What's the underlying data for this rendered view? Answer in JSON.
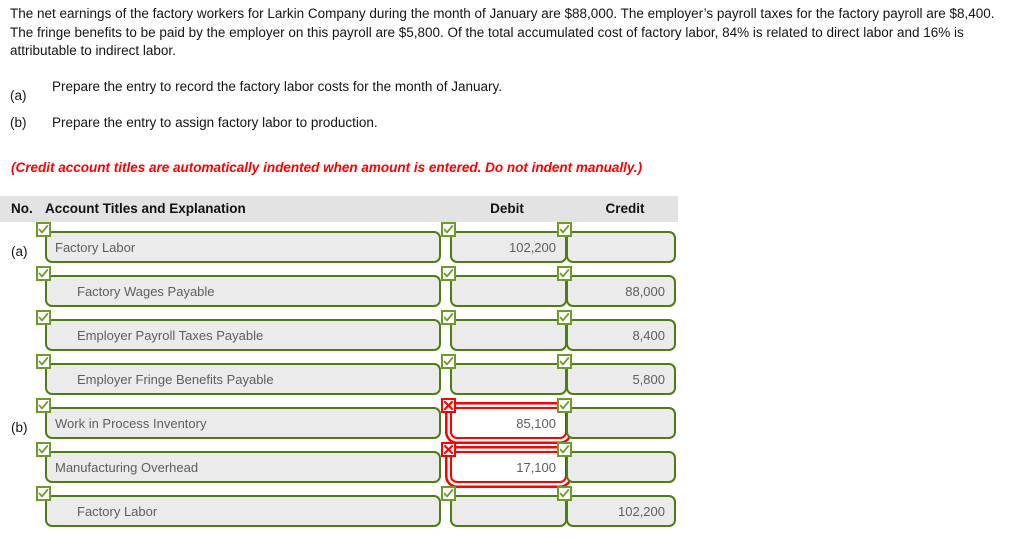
{
  "problem": {
    "text": "The net earnings of the factory workers for Larkin Company during the month of January are $88,000. The employer’s payroll taxes for the factory payroll are $8,400. The fringe benefits to be paid by the employer on this payroll are $5,800. Of the total accumulated cost of factory labor, 84% is related to direct labor and 16% is attributable to indirect labor."
  },
  "requirements": [
    {
      "label": "(a)",
      "text": "Prepare the entry to record the factory labor costs for the month of January."
    },
    {
      "label": "(b)",
      "text": "Prepare the entry to assign factory labor to production."
    }
  ],
  "notice": {
    "text": "(Credit account titles are automatically indented when amount is entered. Do not indent manually.)",
    "color": "#ff0000"
  },
  "table": {
    "headers": {
      "no": "No.",
      "account": "Account Titles and Explanation",
      "debit": "Debit",
      "credit": "Credit"
    },
    "header_bg": "#e3e3e3",
    "valid_color": "#6d9a2a",
    "error_color": "#ff0000",
    "field_border_color": "#4e7d14",
    "rows": [
      {
        "no": "(a)",
        "account": "Factory Labor",
        "indent": false,
        "debit": "102,200",
        "credit": "",
        "account_status": "valid",
        "debit_status": "valid",
        "credit_status": "valid"
      },
      {
        "no": "",
        "account": "Factory Wages Payable",
        "indent": true,
        "debit": "",
        "credit": "88,000",
        "account_status": "valid",
        "debit_status": "valid",
        "credit_status": "valid"
      },
      {
        "no": "",
        "account": "Employer Payroll Taxes Payable",
        "indent": true,
        "debit": "",
        "credit": "8,400",
        "account_status": "valid",
        "debit_status": "valid",
        "credit_status": "valid"
      },
      {
        "no": "",
        "account": "Employer Fringe Benefits Payable",
        "indent": true,
        "debit": "",
        "credit": "5,800",
        "account_status": "valid",
        "debit_status": "valid",
        "credit_status": "valid"
      },
      {
        "no": "(b)",
        "account": "Work in Process Inventory",
        "indent": false,
        "debit": "85,100",
        "credit": "",
        "account_status": "valid",
        "debit_status": "error",
        "credit_status": "valid"
      },
      {
        "no": "",
        "account": "Manufacturing Overhead",
        "indent": false,
        "debit": "17,100",
        "credit": "",
        "account_status": "valid",
        "debit_status": "error",
        "credit_status": "valid"
      },
      {
        "no": "",
        "account": "Factory Labor",
        "indent": true,
        "debit": "",
        "credit": "102,200",
        "account_status": "valid",
        "debit_status": "valid",
        "credit_status": "valid"
      }
    ]
  }
}
